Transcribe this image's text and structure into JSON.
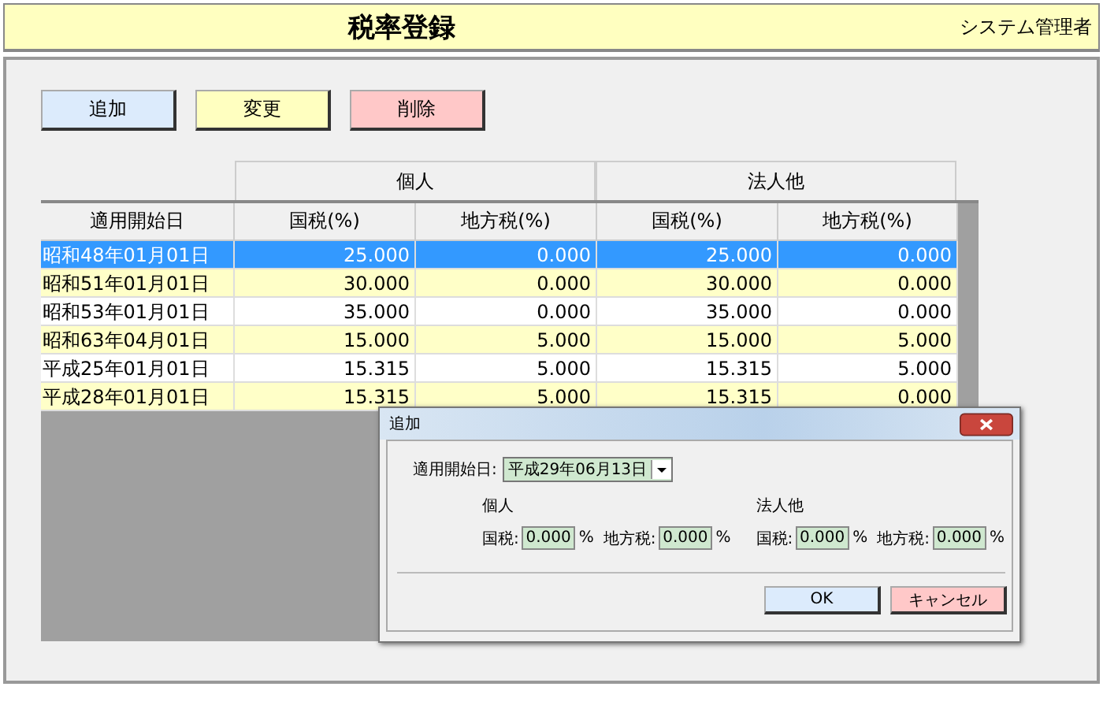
{
  "title": "税率登録",
  "user": "システム管理者",
  "buttons": [
    {
      "label": "追加",
      "kind": "add"
    },
    {
      "label": "変更",
      "kind": "edit"
    },
    {
      "label": "削除",
      "kind": "delete"
    }
  ],
  "table": {
    "groups": [
      "個人",
      "法人他"
    ],
    "columns": [
      "適用開始日",
      "国税(%)",
      "地方税(%)",
      "国税(%)",
      "地方税(%)"
    ],
    "rows": [
      {
        "cells": [
          "昭和48年01月01日",
          "25.000",
          "0.000",
          "25.000",
          "0.000"
        ],
        "selected": true
      },
      {
        "cells": [
          "昭和51年01月01日",
          "30.000",
          "0.000",
          "30.000",
          "0.000"
        ],
        "selected": false
      },
      {
        "cells": [
          "昭和53年01月01日",
          "35.000",
          "0.000",
          "35.000",
          "0.000"
        ],
        "selected": false
      },
      {
        "cells": [
          "昭和63年04月01日",
          "15.000",
          "5.000",
          "15.000",
          "5.000"
        ],
        "selected": false
      },
      {
        "cells": [
          "平成25年01月01日",
          "15.315",
          "5.000",
          "15.315",
          "5.000"
        ],
        "selected": false
      },
      {
        "cells": [
          "平成28年01月01日",
          "15.315",
          "5.000",
          "15.315",
          "0.000"
        ],
        "selected": false
      }
    ]
  },
  "dialog": {
    "title": "追加",
    "date_label": "適用開始日:",
    "date_value": "平成29年06月13日",
    "groups": [
      {
        "label": "個人",
        "fields": [
          {
            "label": "国税:",
            "value": "0.000",
            "unit": "%"
          },
          {
            "label": "地方税:",
            "value": "0.000",
            "unit": "%"
          }
        ]
      },
      {
        "label": "法人他",
        "fields": [
          {
            "label": "国税:",
            "value": "0.000",
            "unit": "%"
          },
          {
            "label": "地方税:",
            "value": "0.000",
            "unit": "%"
          }
        ]
      }
    ],
    "buttons": [
      {
        "label": "OK",
        "kind": "ok"
      },
      {
        "label": "キャンセル",
        "kind": "cancel"
      }
    ]
  }
}
